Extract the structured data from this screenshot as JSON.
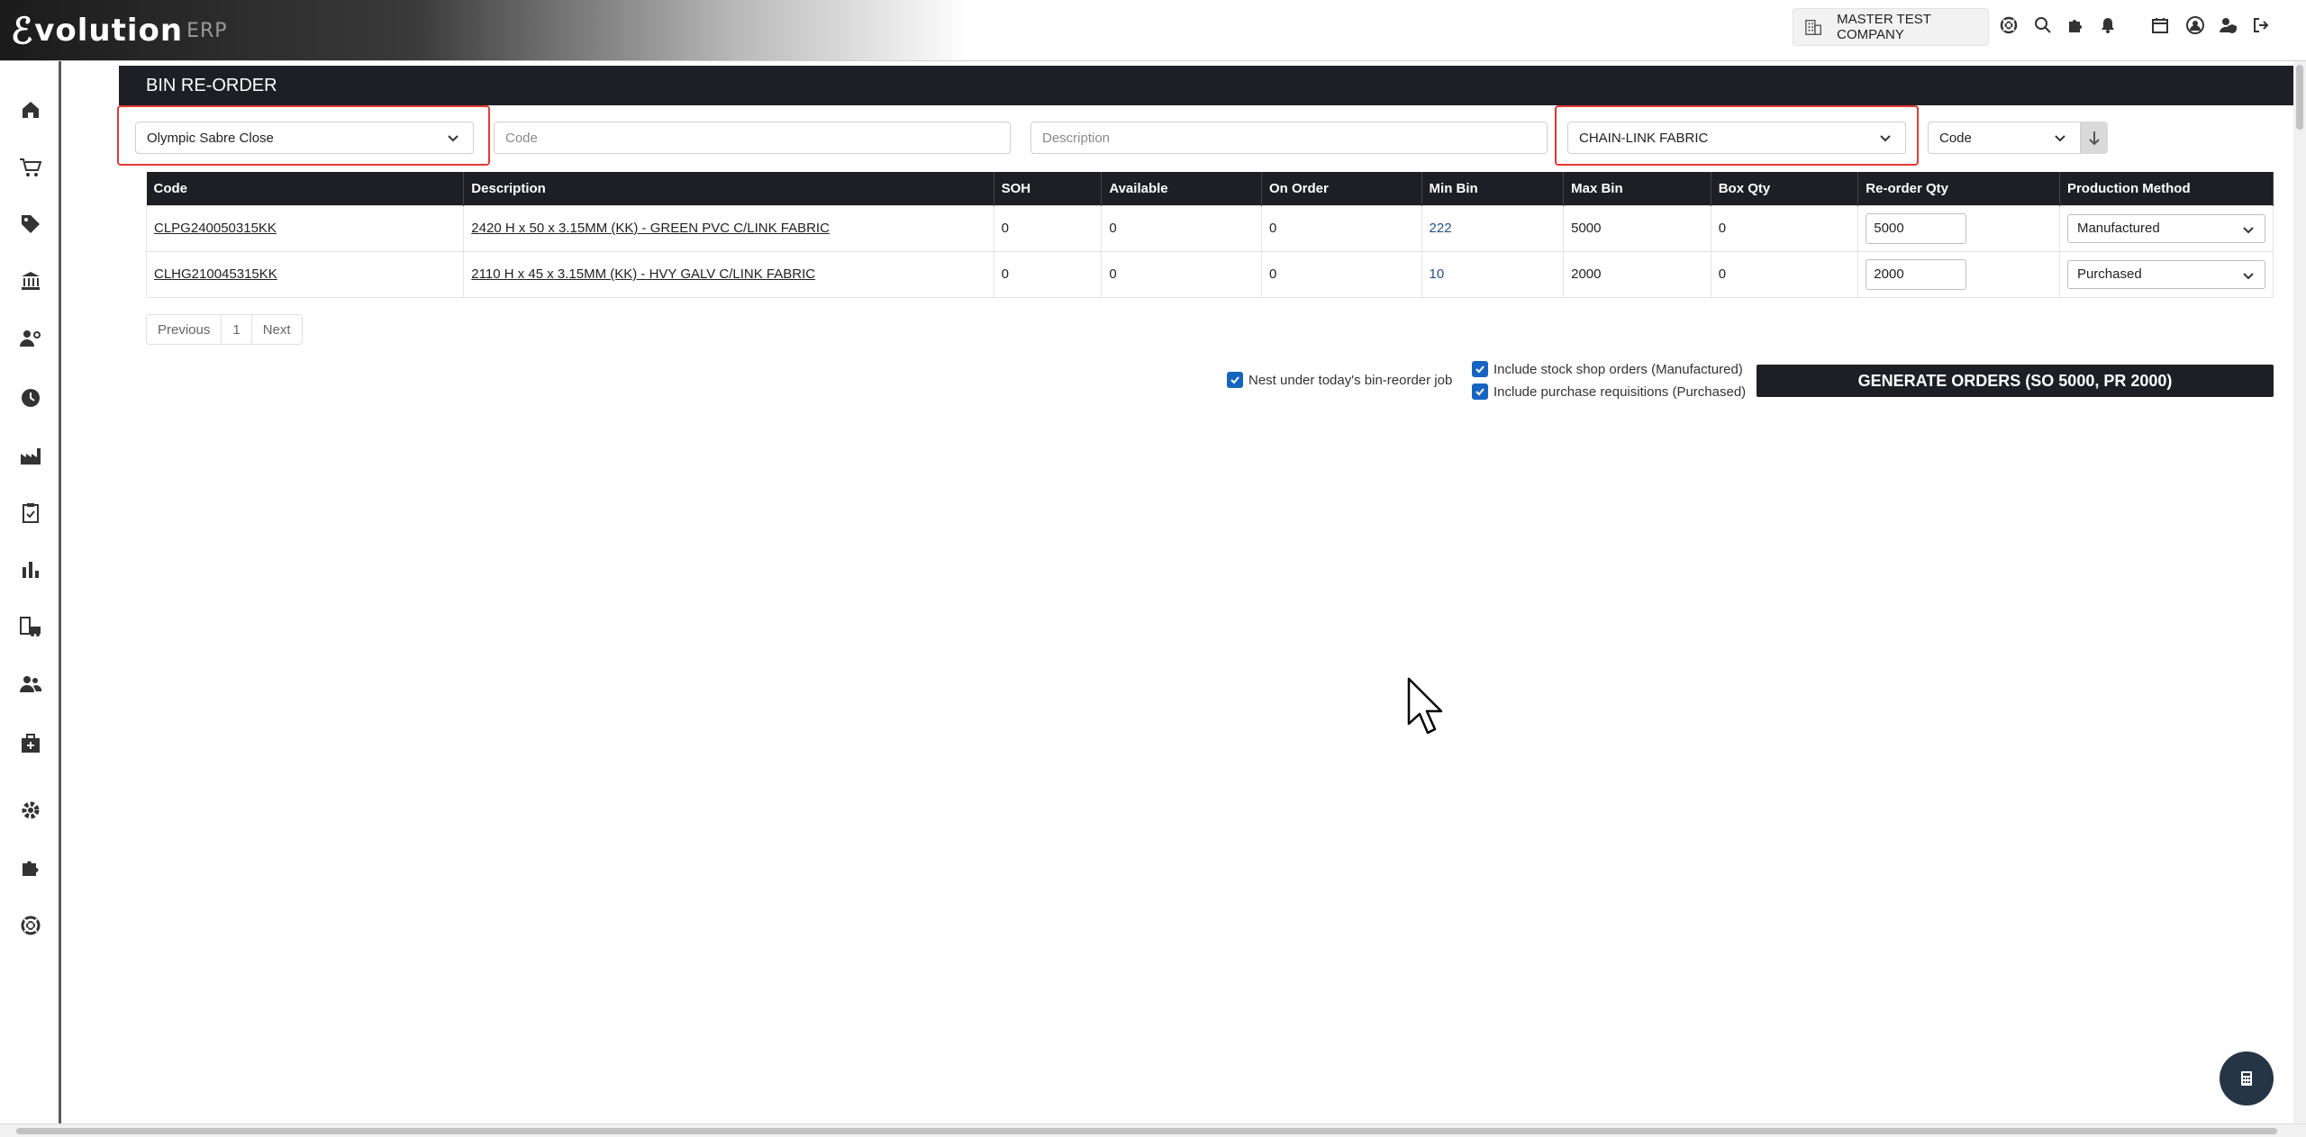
{
  "header": {
    "logo_mark": "ℰ",
    "logo_word": "volution",
    "logo_erp": "ERP",
    "company_name": "MASTER TEST COMPANY"
  },
  "page": {
    "title": "BIN RE-ORDER"
  },
  "filters": {
    "site_value": "Olympic Sabre Close",
    "code_placeholder": "Code",
    "description_placeholder": "Description",
    "category_value": "CHAIN-LINK FABRIC",
    "sort_value": "Code"
  },
  "table": {
    "headers": [
      "Code",
      "Description",
      "SOH",
      "Available",
      "On Order",
      "Min Bin",
      "Max Bin",
      "Box Qty",
      "Re-order Qty",
      "Production Method"
    ],
    "rows": [
      {
        "code": "CLPG240050315KK",
        "description": "2420 H x 50 x 3.15MM (KK) - GREEN PVC C/LINK FABRIC",
        "soh": "0",
        "available": "0",
        "on_order": "0",
        "min_bin": "222",
        "max_bin": "5000",
        "box_qty": "0",
        "reorder_qty": "5000",
        "production_method": "Manufactured"
      },
      {
        "code": "CLHG210045315KK",
        "description": "2110 H x 45 x 3.15MM (KK) - HVY GALV C/LINK FABRIC",
        "soh": "0",
        "available": "0",
        "on_order": "0",
        "min_bin": "10",
        "max_bin": "2000",
        "box_qty": "0",
        "reorder_qty": "2000",
        "production_method": "Purchased"
      }
    ]
  },
  "pagination": {
    "previous": "Previous",
    "page": "1",
    "next": "Next"
  },
  "options": {
    "nest_label": "Nest under today's bin-reorder job",
    "stock_shop_label": "Include stock shop orders (Manufactured)",
    "purchase_req_label": "Include purchase requisitions (Purchased)"
  },
  "generate_button": "GENERATE ORDERS (SO 5000, PR 2000)",
  "colors": {
    "dark": "#1c1f24",
    "accent": "#1565c0",
    "highlight": "#e53935"
  }
}
